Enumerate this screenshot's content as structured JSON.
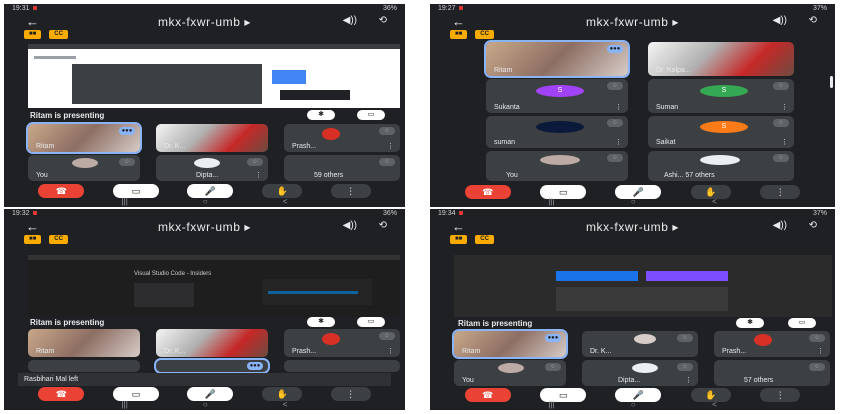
{
  "meeting": {
    "code": "mkx-fxwr-umb",
    "back_glyph": "←",
    "dropdown_glyph": "▸",
    "speaker_glyph": "◀))",
    "camera_glyph": "⟲",
    "badge_a": "■■",
    "badge_b": "CC"
  },
  "screens": [
    {
      "time": "19:31",
      "battery": "36%"
    },
    {
      "time": "19:27",
      "battery": "37%"
    },
    {
      "time": "19:32",
      "battery": "36%"
    },
    {
      "time": "19:34",
      "battery": "37%"
    }
  ],
  "presenting_text": "Ritam is presenting",
  "share_caption_3": "Visual Studio Code - Insiders",
  "tiles_1": [
    {
      "name": "Ritam"
    },
    {
      "name": "Dr. K..."
    },
    {
      "name": "Prash..."
    },
    {
      "name": "You"
    },
    {
      "name": "Dipta..."
    },
    {
      "name": "59 others"
    }
  ],
  "tiles_2": [
    {
      "name": "Ritam"
    },
    {
      "name": "Dr. Kalpa..."
    },
    {
      "name": "Sukanta",
      "initial": "S",
      "color": "#a142f4"
    },
    {
      "name": "Suman",
      "initial": "S",
      "color": "#34a853"
    },
    {
      "name": "suman"
    },
    {
      "name": "Saikat",
      "initial": "S",
      "color": "#fa7b17"
    },
    {
      "name": "You"
    },
    {
      "name": "Ashi... 57 others"
    }
  ],
  "tiles_3": [
    {
      "name": "Ritam"
    },
    {
      "name": "Dr. K..."
    },
    {
      "name": "Prash..."
    }
  ],
  "toast_3": "Rasbihari Mal left",
  "tiles_4": [
    {
      "name": "Ritam"
    },
    {
      "name": "Dr. K..."
    },
    {
      "name": "Prash..."
    },
    {
      "name": "You"
    },
    {
      "name": "Dipta..."
    },
    {
      "name": "57 others"
    }
  ],
  "controls": {
    "hangup_glyph": "☎",
    "video_glyph": "▭",
    "mic_glyph": "🎤",
    "hand_glyph": "✋",
    "more_glyph": "⋮",
    "menu_glyph": "⋮",
    "mic_off_glyph": "◌",
    "talk_glyph": "●●●",
    "pin_glyph": "✱",
    "fit_glyph": "▭"
  },
  "nav": {
    "recent": "|||",
    "home": "○",
    "back": "<"
  }
}
